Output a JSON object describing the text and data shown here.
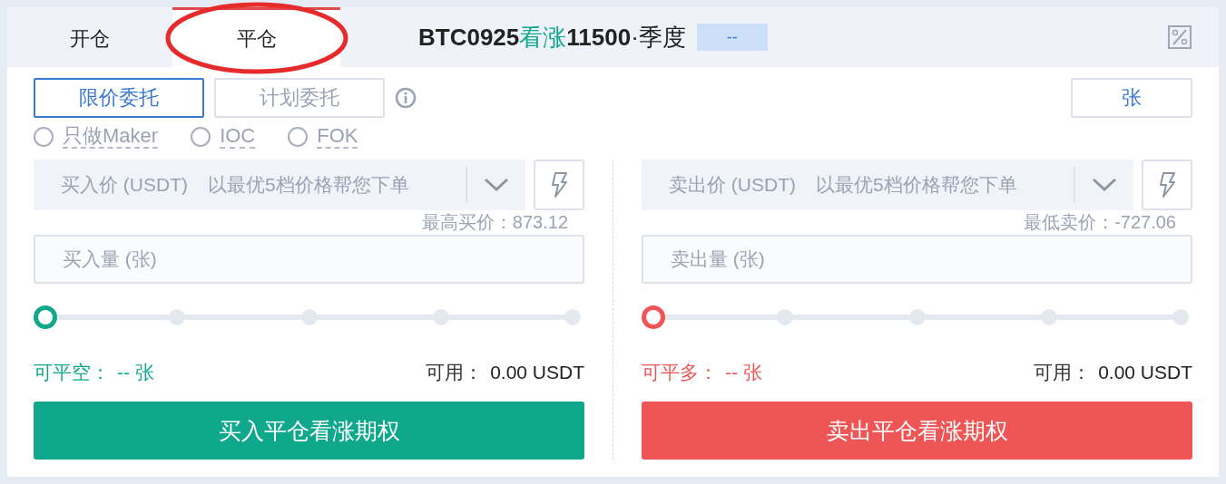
{
  "tabs": [
    {
      "label": "开仓",
      "selected": false
    },
    {
      "label": "平仓",
      "selected": true
    }
  ],
  "contract": {
    "code": "BTC0925",
    "direction": "看涨",
    "strike": "11500",
    "period": "·季度",
    "badge": "--"
  },
  "order_types": [
    {
      "label": "限价委托",
      "selected": true
    },
    {
      "label": "计划委托",
      "selected": false
    }
  ],
  "unit_button": "张",
  "options": [
    {
      "label": "只做Maker",
      "checked": false
    },
    {
      "label": "IOC",
      "checked": false
    },
    {
      "label": "FOK",
      "checked": false
    }
  ],
  "sides": [
    {
      "kind": "buy",
      "price_label": "买入价 (USDT)",
      "price_placeholder": "以最优5档价格帮您下单",
      "best_price": "最高买价：873.12",
      "amount_placeholder": "买入量 (张)",
      "level": 0,
      "closable_label": "可平空：",
      "closable_value": "-- 张",
      "available_label": "可用：",
      "available_value": "0.00 USDT",
      "button": "买入平仓看涨期权"
    },
    {
      "kind": "sell",
      "price_label": "卖出价 (USDT)",
      "price_placeholder": "以最优5档价格帮您下单",
      "best_price": "最低卖价：-727.06",
      "amount_placeholder": "卖出量 (张)",
      "level": 0,
      "closable_label": "可平多：",
      "closable_value": "-- 张",
      "available_label": "可用：",
      "available_value": "0.00 USDT",
      "button": "卖出平仓看涨期权"
    }
  ]
}
